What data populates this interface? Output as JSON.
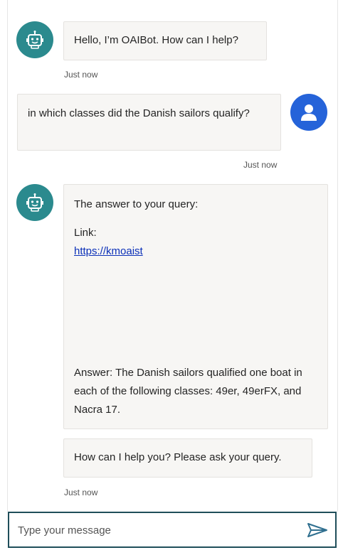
{
  "messages": [
    {
      "sender": "bot",
      "text": "Hello, I’m OAIBot. How can I help?",
      "time": "Just now"
    },
    {
      "sender": "user",
      "text": "in which classes did the Danish sailors qualify?",
      "time": "Just now"
    },
    {
      "sender": "bot",
      "intro": "The answer to your query:",
      "link_label": "Link:",
      "link_text": "https://kmoaist",
      "answer": "Answer: The Danish sailors qualified one boat in each of the following classes: 49er, 49erFX, and Nacra 17."
    },
    {
      "sender": "bot",
      "text": "How can I help you? Please ask your query.",
      "time": "Just now"
    }
  ],
  "input": {
    "placeholder": "Type your message",
    "value": ""
  },
  "icons": {
    "bot_avatar": "robot-icon",
    "user_avatar": "person-icon",
    "send": "send-icon"
  },
  "colors": {
    "bot_avatar": "#2b8a8e",
    "user_avatar": "#2563d9",
    "input_border": "#1f4e5a",
    "send_icon": "#2f6f8f"
  }
}
